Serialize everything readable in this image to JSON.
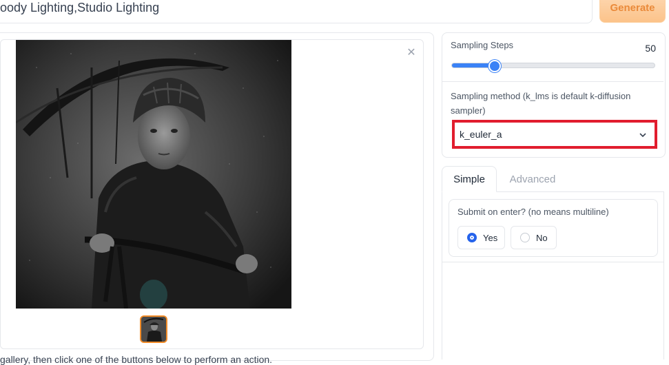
{
  "prompt": {
    "text": "oody Lighting,Studio Lighting"
  },
  "generate_label": "Generate",
  "gallery": {
    "close_symbol": "✕",
    "hint": "gallery, then click one of the buttons below to perform an action."
  },
  "sampling_steps": {
    "label": "Sampling Steps",
    "value": "50",
    "fraction": 0.213
  },
  "sampling_method": {
    "label": "Sampling method (k_lms is default k-diffusion sampler)",
    "selected": "k_euler_a"
  },
  "tabs": [
    {
      "label": "Simple",
      "active": true
    },
    {
      "label": "Advanced",
      "active": false
    }
  ],
  "submit_on_enter": {
    "label": "Submit on enter? (no means multiline)",
    "options": [
      {
        "label": "Yes",
        "selected": true
      },
      {
        "label": "No",
        "selected": false
      }
    ]
  },
  "colors": {
    "accent": "#3b82f6",
    "highlight_border": "#e11d2e",
    "generate_bg": "#fcc38a"
  }
}
